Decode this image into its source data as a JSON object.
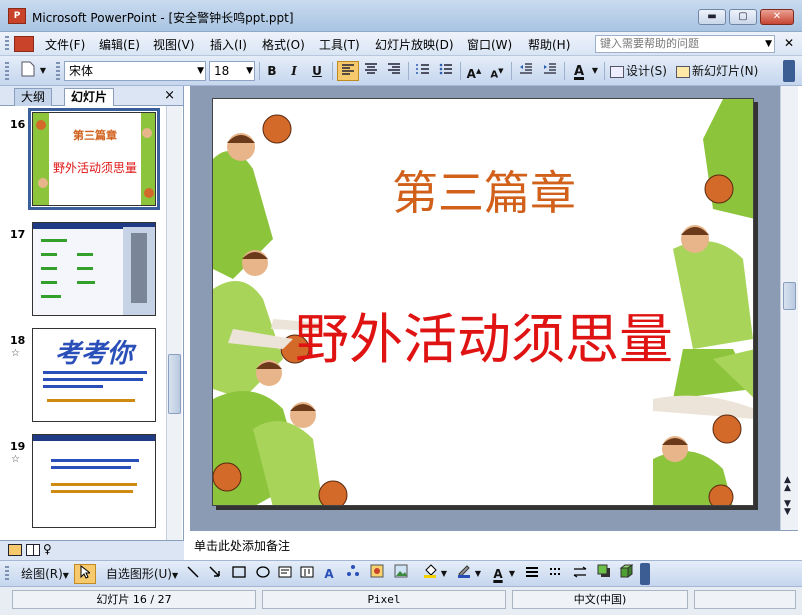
{
  "window": {
    "app_icon_text": "P",
    "title": "Microsoft PowerPoint - [安全警钟长鸣ppt.ppt]",
    "minimize_glyph": "▬",
    "maximize_glyph": "▢",
    "close_glyph": "✕"
  },
  "menu": {
    "items": [
      "文件(F)",
      "编辑(E)",
      "视图(V)",
      "插入(I)",
      "格式(O)",
      "工具(T)",
      "幻灯片放映(D)",
      "窗口(W)",
      "帮助(H)"
    ],
    "help_placeholder": "键入需要帮助的问题",
    "close_glyph": "✕"
  },
  "toolbar": {
    "font_name": "宋体",
    "font_size": "18",
    "bold": "B",
    "italic": "I",
    "underline": "U",
    "design_label": "设计(S)",
    "new_slide_label": "新幻灯片(N)"
  },
  "left_pane": {
    "tabs": [
      "大纲",
      "幻灯片"
    ],
    "active_tab": "幻灯片",
    "close_glyph": "×",
    "slides": [
      {
        "number": "16",
        "title": "第三篇章",
        "subtitle": "野外活动须思量"
      },
      {
        "number": "17"
      },
      {
        "number": "18",
        "heading": "考考你"
      },
      {
        "number": "19"
      }
    ]
  },
  "slide": {
    "title": "第三篇章",
    "subtitle": "野外活动须思量"
  },
  "notes": {
    "placeholder": "单击此处添加备注"
  },
  "drawing_toolbar": {
    "draw_label": "绘图(R)",
    "autoshapes_label": "自选图形(U)"
  },
  "status": {
    "slide_indicator": "幻灯片 16 / 27",
    "design": "Pixel",
    "language": "中文(中国)"
  },
  "colors": {
    "title_color": "#d0601a",
    "subtitle_color": "#e01313",
    "jersey_green": "#8cc43c"
  }
}
